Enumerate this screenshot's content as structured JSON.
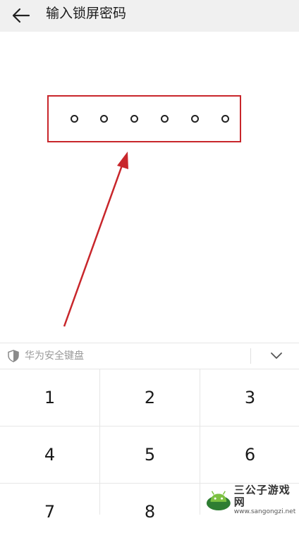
{
  "header": {
    "title": "输入锁屏密码",
    "back_icon": "arrow-left-icon"
  },
  "pin": {
    "length": 6,
    "filled": 0,
    "highlight_color": "#c8262b"
  },
  "keyboard": {
    "label": "华为安全键盘",
    "shield_icon": "shield-icon",
    "collapse_icon": "chevron-down-icon",
    "keys": [
      "1",
      "2",
      "3",
      "4",
      "5",
      "6",
      "7",
      "8"
    ]
  },
  "watermark": {
    "name": "三公子游戏网",
    "url": "www.sangongzi.net"
  }
}
